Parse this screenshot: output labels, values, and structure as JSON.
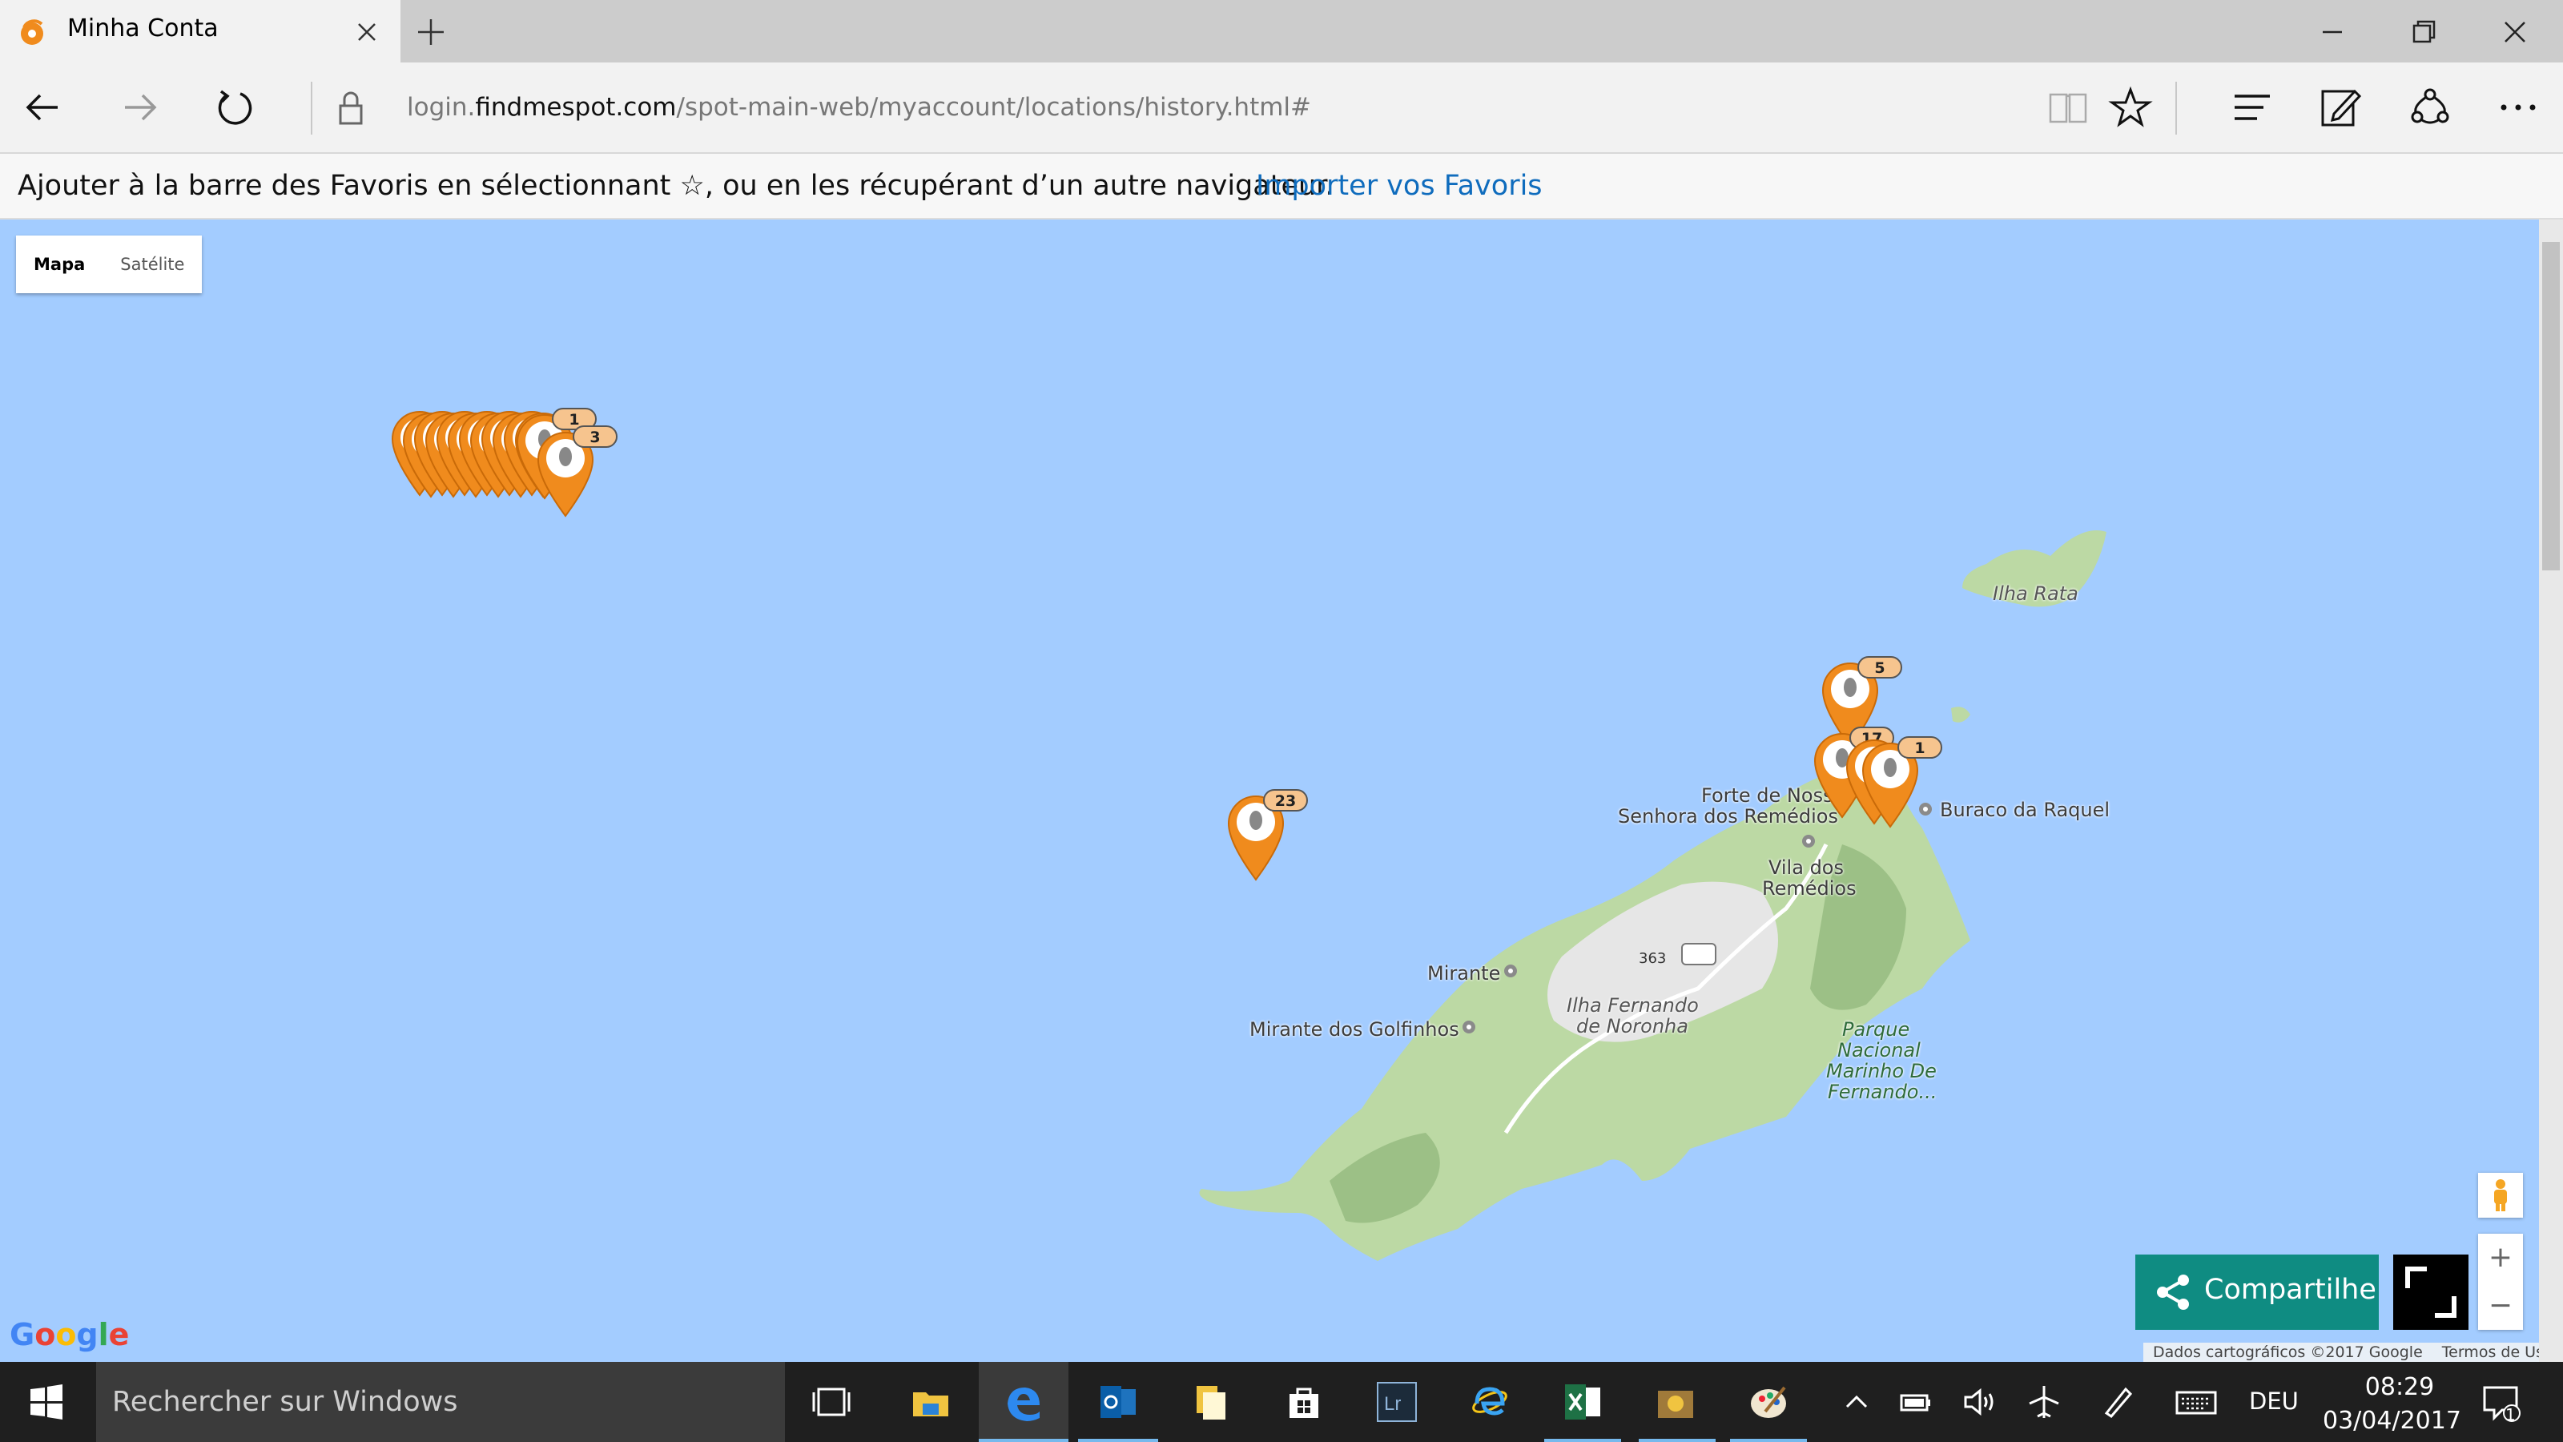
{
  "browser": {
    "tab_title": "Minha Conta",
    "url_prefix": "login.",
    "url_domain": "findmespot.com",
    "url_path": "/spot-main-web/myaccount/locations/history.html#"
  },
  "favorites_bar": {
    "text": "Ajouter à la barre des Favoris en sélectionnant ☆, ou en les récupérant d’un autre navigateur.",
    "link": "Importer vos Favoris"
  },
  "map": {
    "type_buttons": [
      "Mapa",
      "Satélite"
    ],
    "selected_type": "Mapa",
    "labels": {
      "ilha_rata": "Ilha Rata",
      "forte_1": "Forte de Nossa",
      "forte_2": "Senhora dos Remédios",
      "buraco": "Buraco da Raquel",
      "vila_1": "Vila dos",
      "vila_2": "Remédios",
      "mirante": "Mirante",
      "golfinhos": "Mirante dos Golfinhos",
      "ilha_1": "Ilha Fernando",
      "ilha_2": "de Noronha",
      "parque_1": "Parque",
      "parque_2": "Nacional",
      "parque_3": "Marinho De",
      "parque_4": "Fernando...",
      "road": "363"
    },
    "markers": [
      {
        "count": "1"
      },
      {
        "count": "3"
      },
      {
        "count": "23"
      },
      {
        "count": "5"
      },
      {
        "count": "17"
      },
      {
        "count": "1"
      }
    ],
    "google_logo": "Google",
    "attribution": "Dados cartográficos ©2017 Google",
    "terms": "Termos de Uso",
    "share_label": "Compartilhe",
    "zoom_in": "+",
    "zoom_out": "−"
  },
  "taskbar": {
    "search_placeholder": "Rechercher sur Windows",
    "language": "DEU",
    "time": "08:29",
    "date": "03/04/2017",
    "notification_count": "1"
  },
  "colors": {
    "marker": "#f08b1d",
    "water": "#a3ccff",
    "share_button": "#0f8c82"
  }
}
